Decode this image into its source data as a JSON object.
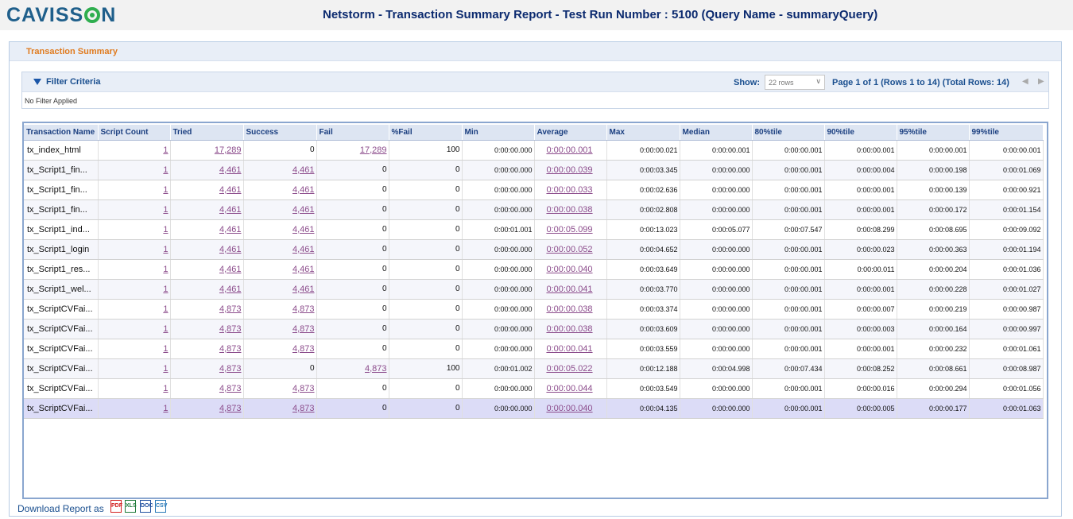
{
  "logo": {
    "pre": "CAVISS",
    "post": "N"
  },
  "title": "Netstorm - Transaction Summary Report - Test Run Number : 5100 (Query Name - summaryQuery)",
  "panel_title": "Transaction Summary",
  "filter": {
    "label": "Filter Criteria",
    "show_label": "Show:",
    "rows_value": "22 rows",
    "page_info": "Page 1 of 1 (Rows 1 to 14) (Total Rows: 14)",
    "prev": "◀",
    "next": "▶",
    "status": "No Filter Applied"
  },
  "table": {
    "columns": [
      "Transaction Name",
      "Script Count",
      "Tried",
      "Success",
      "Fail",
      "%Fail",
      "Min",
      "Average",
      "Max",
      "Median",
      "80%tile",
      "90%tile",
      "95%tile",
      "99%tile"
    ],
    "rows": [
      [
        "tx_index_html",
        "1",
        "17,289",
        "0",
        "17,289",
        "100",
        "0:00:00.000",
        "0:00:00.001",
        "0:00:00.021",
        "0:00:00.001",
        "0:00:00.001",
        "0:00:00.001",
        "0:00:00.001",
        "0:00:00.001"
      ],
      [
        "tx_Script1_fin...",
        "1",
        "4,461",
        "4,461",
        "0",
        "0",
        "0:00:00.000",
        "0:00:00.039",
        "0:00:03.345",
        "0:00:00.000",
        "0:00:00.001",
        "0:00:00.004",
        "0:00:00.198",
        "0:00:01.069"
      ],
      [
        "tx_Script1_fin...",
        "1",
        "4,461",
        "4,461",
        "0",
        "0",
        "0:00:00.000",
        "0:00:00.033",
        "0:00:02.636",
        "0:00:00.000",
        "0:00:00.001",
        "0:00:00.001",
        "0:00:00.139",
        "0:00:00.921"
      ],
      [
        "tx_Script1_fin...",
        "1",
        "4,461",
        "4,461",
        "0",
        "0",
        "0:00:00.000",
        "0:00:00.038",
        "0:00:02.808",
        "0:00:00.000",
        "0:00:00.001",
        "0:00:00.001",
        "0:00:00.172",
        "0:00:01.154"
      ],
      [
        "tx_Script1_ind...",
        "1",
        "4,461",
        "4,461",
        "0",
        "0",
        "0:00:01.001",
        "0:00:05.099",
        "0:00:13.023",
        "0:00:05.077",
        "0:00:07.547",
        "0:00:08.299",
        "0:00:08.695",
        "0:00:09.092"
      ],
      [
        "tx_Script1_login",
        "1",
        "4,461",
        "4,461",
        "0",
        "0",
        "0:00:00.000",
        "0:00:00.052",
        "0:00:04.652",
        "0:00:00.000",
        "0:00:00.001",
        "0:00:00.023",
        "0:00:00.363",
        "0:00:01.194"
      ],
      [
        "tx_Script1_res...",
        "1",
        "4,461",
        "4,461",
        "0",
        "0",
        "0:00:00.000",
        "0:00:00.040",
        "0:00:03.649",
        "0:00:00.000",
        "0:00:00.001",
        "0:00:00.011",
        "0:00:00.204",
        "0:00:01.036"
      ],
      [
        "tx_Script1_wel...",
        "1",
        "4,461",
        "4,461",
        "0",
        "0",
        "0:00:00.000",
        "0:00:00.041",
        "0:00:03.770",
        "0:00:00.000",
        "0:00:00.001",
        "0:00:00.001",
        "0:00:00.228",
        "0:00:01.027"
      ],
      [
        "tx_ScriptCVFai...",
        "1",
        "4,873",
        "4,873",
        "0",
        "0",
        "0:00:00.000",
        "0:00:00.038",
        "0:00:03.374",
        "0:00:00.000",
        "0:00:00.001",
        "0:00:00.007",
        "0:00:00.219",
        "0:00:00.987"
      ],
      [
        "tx_ScriptCVFai...",
        "1",
        "4,873",
        "4,873",
        "0",
        "0",
        "0:00:00.000",
        "0:00:00.038",
        "0:00:03.609",
        "0:00:00.000",
        "0:00:00.001",
        "0:00:00.003",
        "0:00:00.164",
        "0:00:00.997"
      ],
      [
        "tx_ScriptCVFai...",
        "1",
        "4,873",
        "4,873",
        "0",
        "0",
        "0:00:00.000",
        "0:00:00.041",
        "0:00:03.559",
        "0:00:00.000",
        "0:00:00.001",
        "0:00:00.001",
        "0:00:00.232",
        "0:00:01.061"
      ],
      [
        "tx_ScriptCVFai...",
        "1",
        "4,873",
        "0",
        "4,873",
        "100",
        "0:00:01.002",
        "0:00:05.022",
        "0:00:12.188",
        "0:00:04.998",
        "0:00:07.434",
        "0:00:08.252",
        "0:00:08.661",
        "0:00:08.987"
      ],
      [
        "tx_ScriptCVFai...",
        "1",
        "4,873",
        "4,873",
        "0",
        "0",
        "0:00:00.000",
        "0:00:00.044",
        "0:00:03.549",
        "0:00:00.000",
        "0:00:00.001",
        "0:00:00.016",
        "0:00:00.294",
        "0:00:01.056"
      ],
      [
        "tx_ScriptCVFai...",
        "1",
        "4,873",
        "4,873",
        "0",
        "0",
        "0:00:00.000",
        "0:00:00.040",
        "0:00:04.135",
        "0:00:00.000",
        "0:00:00.001",
        "0:00:00.005",
        "0:00:00.177",
        "0:00:01.063"
      ]
    ]
  },
  "download": {
    "label": "Download Report as",
    "formats": [
      "PDF",
      "XLS",
      "DOC",
      "CSV"
    ],
    "colors": {
      "pdf": "#d32020",
      "xls": "#1f7a3a",
      "doc": "#1f4f9f",
      "csv": "#2a7ab8"
    }
  },
  "colors": {
    "title": "#0b2a6f",
    "accent": "#e07b1f",
    "link": "#8b4b8b",
    "header_text": "#1b3f80"
  }
}
